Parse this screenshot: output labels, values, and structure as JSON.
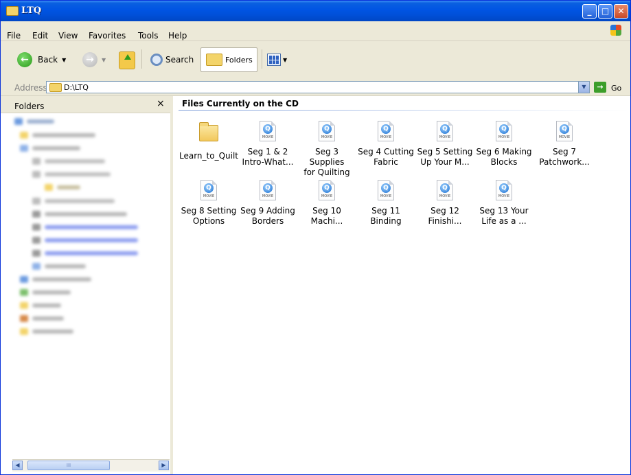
{
  "window": {
    "title": "LTQ"
  },
  "menu": [
    "File",
    "Edit",
    "View",
    "Favorites",
    "Tools",
    "Help"
  ],
  "toolbar": {
    "back_label": "Back",
    "search_label": "Search",
    "folders_label": "Folders"
  },
  "address": {
    "label": "Address",
    "value": "D:\\LTQ",
    "go_label": "Go"
  },
  "folders_pane": {
    "title": "Folders",
    "close_glyph": "×",
    "scroll_glyph": "III"
  },
  "content": {
    "group_title": "Files Currently on the CD",
    "items": [
      {
        "type": "folder",
        "label": "Learn_to_Quilt"
      },
      {
        "type": "movie",
        "label": "Seg 1 & 2\nIntro-What..."
      },
      {
        "type": "movie",
        "label": "Seg 3 Supplies\nfor Quilting"
      },
      {
        "type": "movie",
        "label": "Seg 4 Cutting\nFabric"
      },
      {
        "type": "movie",
        "label": "Seg 5 Setting\nUp Your M..."
      },
      {
        "type": "movie",
        "label": "Seg 6 Making\nBlocks"
      },
      {
        "type": "movie",
        "label": "Seg 7\nPatchwork..."
      },
      {
        "type": "movie",
        "label": "Seg 8 Setting\nOptions"
      },
      {
        "type": "movie",
        "label": "Seg 9 Adding\nBorders"
      },
      {
        "type": "movie",
        "label": "Seg 10\nMachi..."
      },
      {
        "type": "movie",
        "label": "Seg 11 Binding"
      },
      {
        "type": "movie",
        "label": "Seg 12\nFinishi..."
      },
      {
        "type": "movie",
        "label": "Seg 13 Your\nLife as a ..."
      }
    ],
    "movie_tag": "MOVIE"
  },
  "colors": {
    "titlebar": "#0054e3",
    "chrome": "#ece9d8",
    "accent_blue": "#316ac5"
  }
}
